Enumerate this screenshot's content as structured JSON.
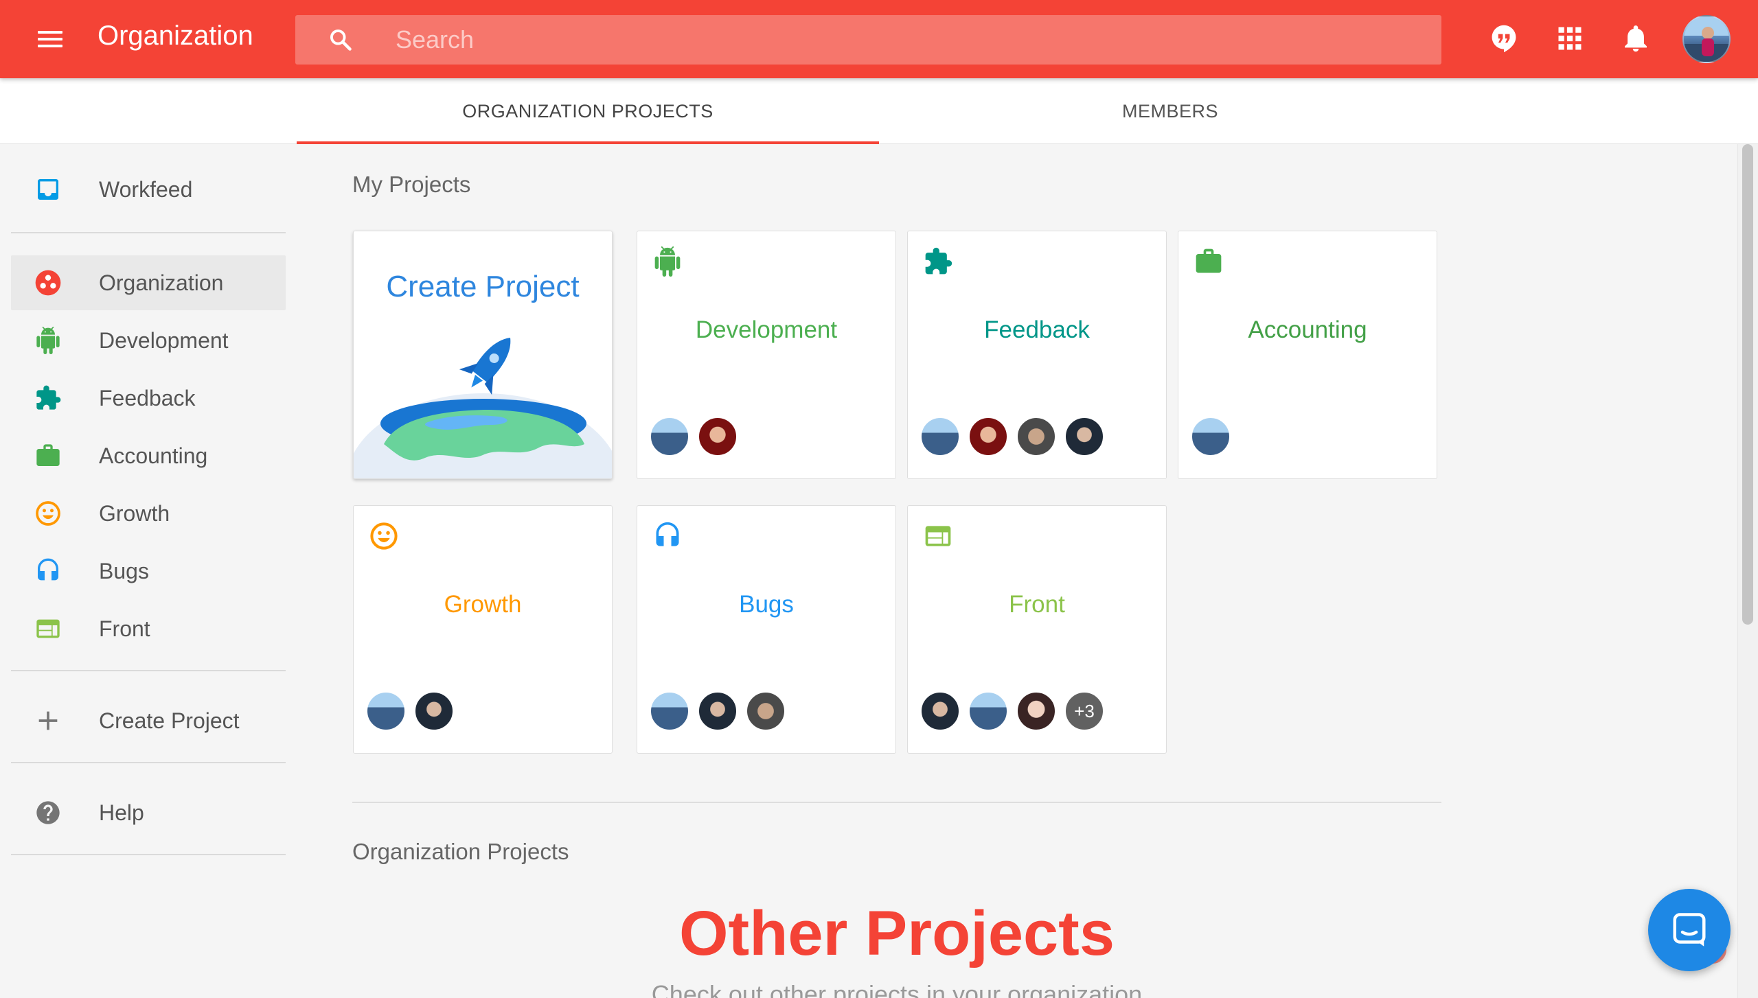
{
  "topbar": {
    "title": "Organization",
    "search_placeholder": "Search",
    "icons": [
      "menu-icon",
      "search-icon",
      "hangouts-icon",
      "apps-icon",
      "notifications-icon",
      "user-avatar"
    ],
    "brand_color": "#f44336"
  },
  "tabs": [
    {
      "label": "ORGANIZATION PROJECTS",
      "active": true
    },
    {
      "label": "MEMBERS",
      "active": false
    }
  ],
  "sidebar": {
    "items": [
      {
        "label": "Workfeed",
        "icon": "inbox-icon",
        "color": "#039be5"
      },
      {
        "label": "Organization",
        "icon": "organization-icon",
        "color": "#f44336",
        "selected": true
      },
      {
        "label": "Development",
        "icon": "android-icon",
        "color": "#4caf50"
      },
      {
        "label": "Feedback",
        "icon": "puzzle-icon",
        "color": "#009688"
      },
      {
        "label": "Accounting",
        "icon": "briefcase-icon",
        "color": "#4caf50"
      },
      {
        "label": "Growth",
        "icon": "smile-icon",
        "color": "#ff9800"
      },
      {
        "label": "Bugs",
        "icon": "headset-icon",
        "color": "#2196f3"
      },
      {
        "label": "Front",
        "icon": "web-icon",
        "color": "#8bc34a"
      },
      {
        "label": "Create Project",
        "icon": "plus-icon",
        "color": "#757575"
      },
      {
        "label": "Help",
        "icon": "help-icon",
        "color": "#757575"
      }
    ]
  },
  "main": {
    "my_projects_title": "My Projects",
    "create_card": {
      "label": "Create Project",
      "icon": "rocket-icon"
    },
    "projects": [
      {
        "name": "Development",
        "icon": "android-icon",
        "color": "#4caf50",
        "members": 2
      },
      {
        "name": "Feedback",
        "icon": "puzzle-icon",
        "color": "#009688",
        "members": 4
      },
      {
        "name": "Accounting",
        "icon": "briefcase-icon",
        "color": "#43a047",
        "members": 1
      },
      {
        "name": "Growth",
        "icon": "smile-icon",
        "color": "#ff9800",
        "members": 2
      },
      {
        "name": "Bugs",
        "icon": "headset-icon",
        "color": "#2196f3",
        "members": 3
      },
      {
        "name": "Front",
        "icon": "web-icon",
        "color": "#8bc34a",
        "members": 3,
        "extra": "+3"
      }
    ],
    "org_projects_title": "Organization Projects",
    "other_title": "Other Projects",
    "other_subtitle": "Check out other projects in your organization"
  },
  "chat": {
    "icon": "chat-icon"
  }
}
